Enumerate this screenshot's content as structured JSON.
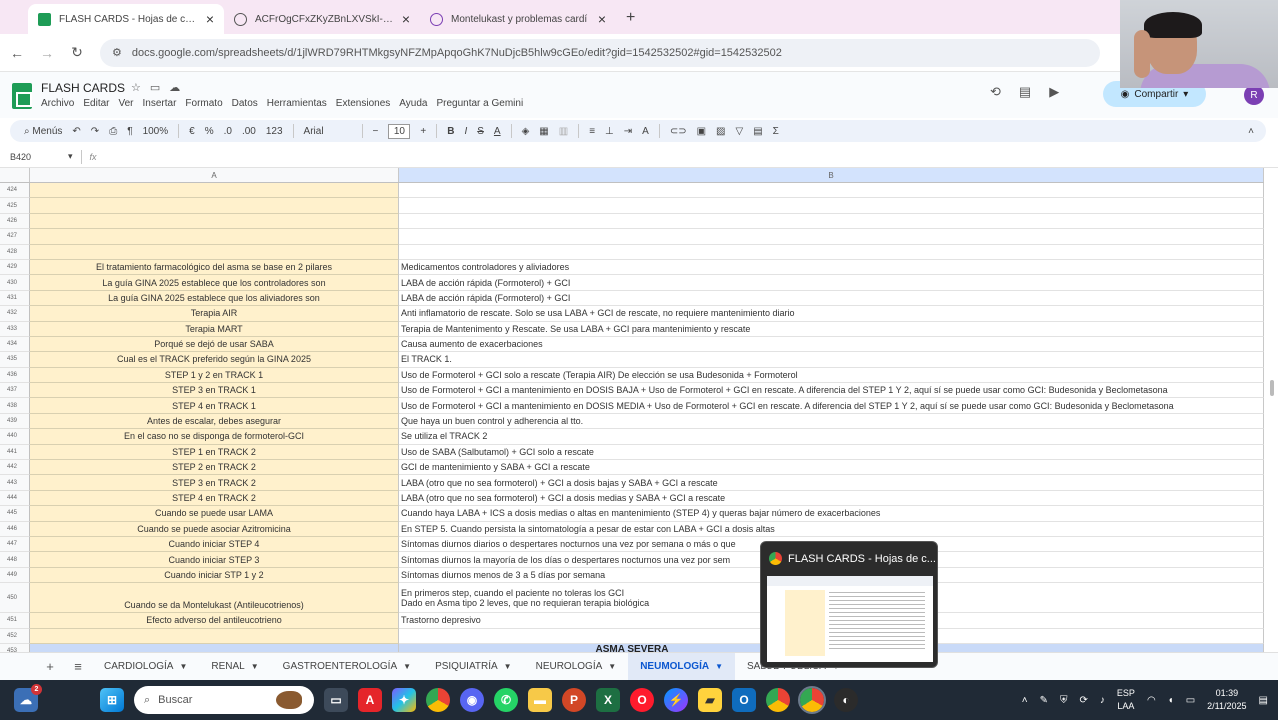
{
  "browser": {
    "tabs": [
      {
        "label": "FLASH CARDS - Hojas de cálcu",
        "active": true,
        "favicon_color": "#1e9c56"
      },
      {
        "label": "ACFrOgCFxZKyZBnLXVSkI-Z6y-",
        "active": false,
        "favicon_color": "#555555"
      },
      {
        "label": "Montelukast y problemas cardí",
        "active": false,
        "favicon_color": "#7b3fb3"
      }
    ],
    "url": "docs.google.com/spreadsheets/d/1jlWRD79RHTMkgsyNFZMpApqoGhK7NuDjcB5hlw9cGEo/edit?gid=1542532502#gid=1542532502"
  },
  "sheets": {
    "doc_title": "FLASH CARDS",
    "menu": [
      "Archivo",
      "Editar",
      "Ver",
      "Insertar",
      "Formato",
      "Datos",
      "Herramientas",
      "Extensiones",
      "Ayuda",
      "Preguntar a Gemini"
    ],
    "share_label": "Compartir",
    "avatar_letter": "R",
    "toolbar": {
      "menus": "Menús",
      "zoom": "100%",
      "currency": "€",
      "percent": "%",
      "dec_less": ".0",
      "dec_more": ".00",
      "number_format": "123",
      "font": "Arial",
      "font_size": "10"
    },
    "name_box": "B420",
    "fx": "fx",
    "columns": [
      "A",
      "B"
    ],
    "rows": [
      {
        "n": "424",
        "a": "",
        "b": ""
      },
      {
        "n": "425",
        "a": "",
        "b": ""
      },
      {
        "n": "426",
        "a": "",
        "b": ""
      },
      {
        "n": "427",
        "a": "",
        "b": ""
      },
      {
        "n": "428",
        "a": "",
        "b": ""
      },
      {
        "n": "429",
        "a": "El tratamiento farmacológico del asma se base en 2 pilares",
        "b": "Medicamentos controladores y aliviadores"
      },
      {
        "n": "430",
        "a": "La guía GINA 2025 establece que los controladores son",
        "b": "LABA de acción rápida (Formoterol) + GCI"
      },
      {
        "n": "431",
        "a": "La guía GINA 2025 establece que los aliviadores son",
        "b": "LABA de acción rápida (Formoterol) + GCI"
      },
      {
        "n": "432",
        "a": "Terapia AIR",
        "b": "Anti inflamatorio de rescate. Solo se usa LABA + GCI de rescate, no requiere mantenimiento diario"
      },
      {
        "n": "433",
        "a": "Terapia MART",
        "b": "Terapia de Mantenimento y Rescate. Se usa LABA + GCI para mantenimiento y rescate"
      },
      {
        "n": "434",
        "a": "Porqué se dejó de usar SABA",
        "b": "Causa aumento de exacerbaciones"
      },
      {
        "n": "435",
        "a": "Cual es el TRACK preferido según la GINA 2025",
        "b": "El TRACK 1."
      },
      {
        "n": "436",
        "a": "STEP 1 y 2 en TRACK 1",
        "b": "Uso de Formoterol + GCI solo a rescate (Terapia AIR) De elección se usa Budesonida + Formoterol"
      },
      {
        "n": "437",
        "a": "STEP 3 en TRACK 1",
        "b": "Uso de Formoterol + GCI a mantenimiento en DOSIS BAJA + Uso de Formoterol + GCI en rescate. A diferencia del STEP 1 Y 2, aquí sí se puede usar como GCI: Budesonida y Beclometasona"
      },
      {
        "n": "438",
        "a": "STEP 4 en TRACK 1",
        "b": "Uso de Formoterol + GCI a mantenimiento en DOSIS MEDIA + Uso de Formoterol + GCI en rescate. A diferencia del STEP 1 Y 2, aquí sí se puede usar como GCI: Budesonida y Beclometasona"
      },
      {
        "n": "439",
        "a": "Antes de escalar, debes asegurar",
        "b": "Que haya un buen control y adherencia al tto."
      },
      {
        "n": "440",
        "a": "En el caso no se disponga de formoterol-GCI",
        "b": "Se utiliza el TRACK 2"
      },
      {
        "n": "441",
        "a": "STEP 1 en TRACK 2",
        "b": "Uso de SABA (Salbutamol) + GCI solo a rescate"
      },
      {
        "n": "442",
        "a": "STEP 2 en TRACK 2",
        "b": "GCI de mantenimiento y SABA + GCI a rescate"
      },
      {
        "n": "443",
        "a": "STEP 3 en TRACK 2",
        "b": "LABA (otro que no sea formoterol) + GCI a dosis bajas y SABA + GCI a rescate"
      },
      {
        "n": "444",
        "a": "STEP 4 en TRACK 2",
        "b": "LABA (otro que no sea formoterol) + GCI a dosis medias y SABA + GCI a rescate"
      },
      {
        "n": "445",
        "a": "Cuando se puede usar LAMA",
        "b": "Cuando haya LABA + ICS a dosis medias o altas en mantenimiento (STEP 4) y queras bajar número de exacerbaciones"
      },
      {
        "n": "446",
        "a": "Cuando se puede asociar Azitromicina",
        "b": "En STEP 5. Cuando persista la sintomatología a pesar de estar con LABA + GCI a dosis altas"
      },
      {
        "n": "447",
        "a": "Cuando iniciar STEP 4",
        "b": "Síntomas diurnos diarios o despertares nocturnos una vez por semana o más o que"
      },
      {
        "n": "448",
        "a": "Cuando iniciar STEP 3",
        "b": "Síntomas diurnos la mayoría de los días o despertares nocturnos una vez por sem"
      },
      {
        "n": "449",
        "a": "Cuando iniciar STP 1 y 2",
        "b": "Síntomas diurnos menos de 3 a 5 días por semana"
      },
      {
        "n": "450",
        "a": "Cuando se da Montelukast (Antileucotrienos)",
        "b": "En primeros step, cuando el paciente no toleras los GCI",
        "b2": "Dado en Asma tipo 2 leves, que no requieran terapia biológica",
        "tall": true
      },
      {
        "n": "451",
        "a": "Efecto adverso del antileucotrieno",
        "b": "Trastorno depresivo"
      },
      {
        "n": "452",
        "a": "",
        "b": ""
      },
      {
        "n": "453",
        "a": "",
        "b": "",
        "banner": "ASMA SEVERA"
      }
    ],
    "sheet_tabs": [
      {
        "label": "CARDIOLOGÍA",
        "active": false
      },
      {
        "label": "RENAL",
        "active": false
      },
      {
        "label": "GASTROENTEROLOGÍA",
        "active": false
      },
      {
        "label": "PSIQUIATRÍA",
        "active": false
      },
      {
        "label": "NEUROLOGÍA",
        "active": false
      },
      {
        "label": "NEUMOLOGÍA",
        "active": true
      },
      {
        "label": "SALUD PÚBLICA",
        "active": false
      }
    ]
  },
  "preview": {
    "title": "FLASH CARDS - Hojas de c..."
  },
  "taskbar": {
    "search_placeholder": "Buscar",
    "badge": "2",
    "lang_line1": "ESP",
    "lang_line2": "LAA",
    "time": "01:39",
    "date": "2/11/2025"
  }
}
